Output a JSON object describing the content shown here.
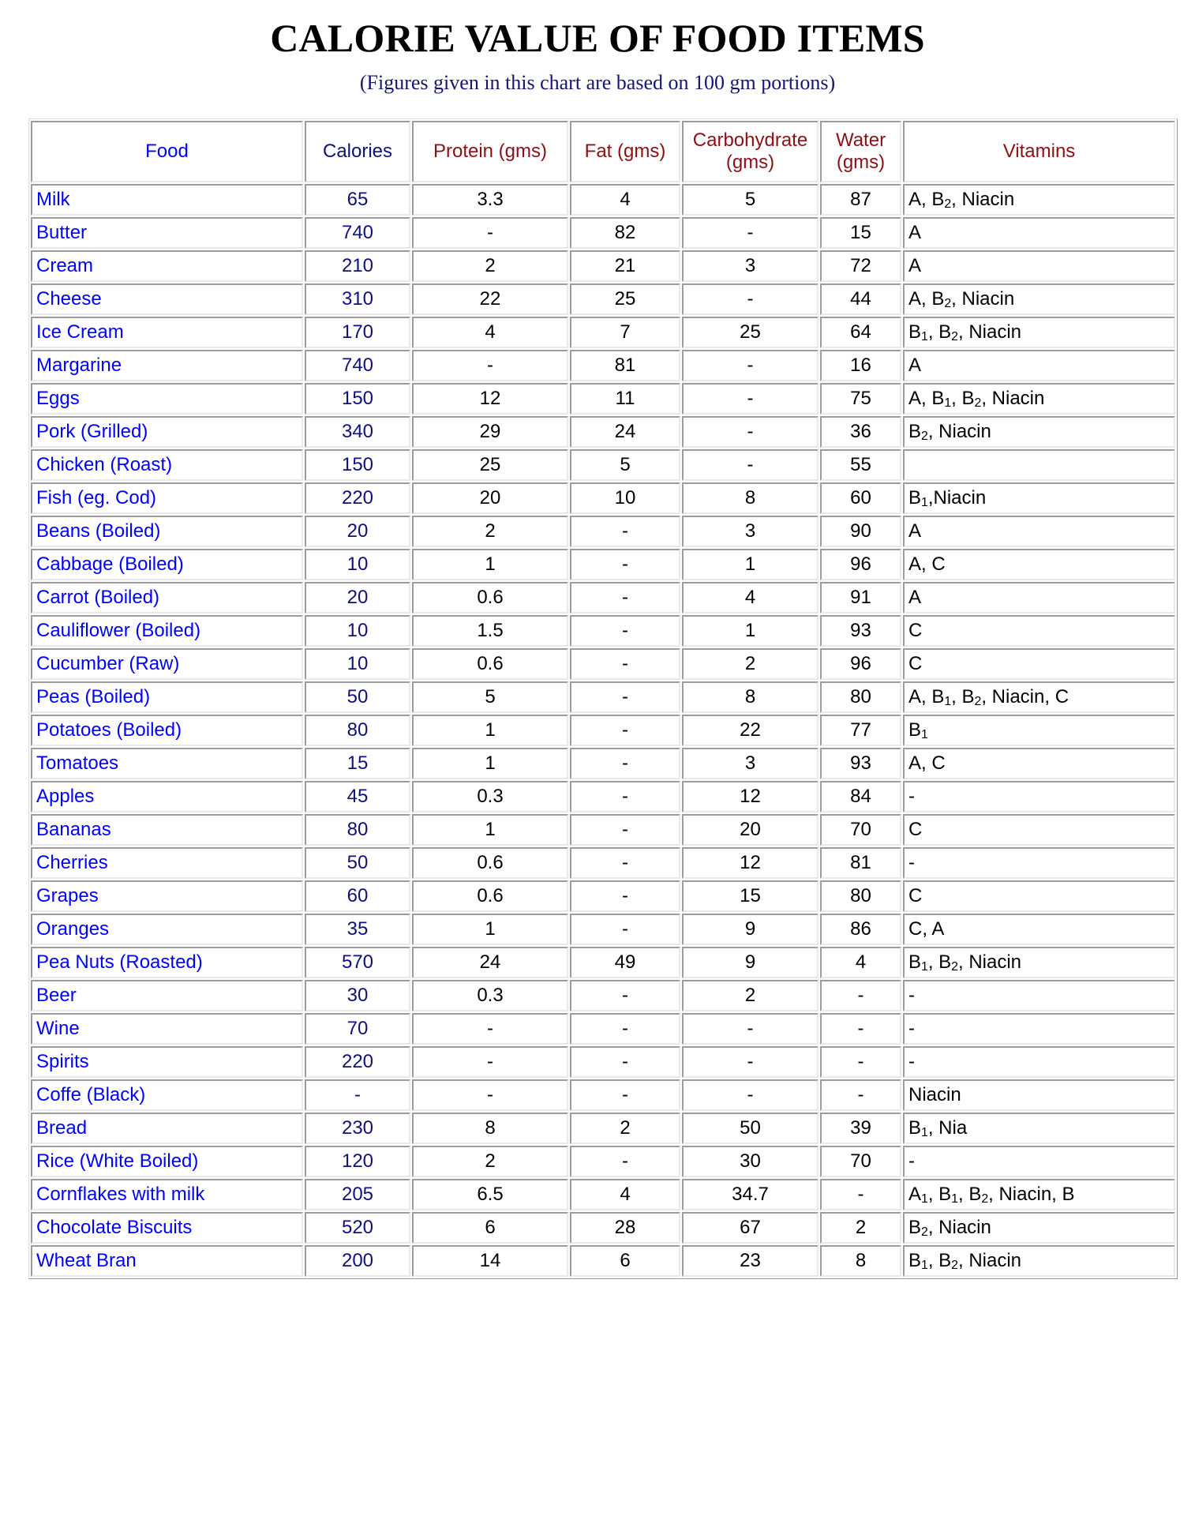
{
  "header": {
    "title": "CALORIE VALUE OF FOOD ITEMS",
    "subtitle": "(Figures given in this chart are based on 100 gm portions)",
    "title_color": "#000000",
    "subtitle_color": "#16166e"
  },
  "colors": {
    "food_text": "#0000ff",
    "calories_text": "#10107a",
    "numeric_text": "#000000",
    "header_red": "#8b1015",
    "header_blue_bright": "#0000ff",
    "header_blue_dark": "#10107a",
    "cell_border": "#9c9c9c",
    "page_background": "#ffffff"
  },
  "table": {
    "columns": [
      {
        "label": "Food",
        "color_role": "header_blue_bright"
      },
      {
        "label": "Calories",
        "color_role": "header_blue_dark"
      },
      {
        "label": "Protein (gms)",
        "color_role": "header_red"
      },
      {
        "label": "Fat (gms)",
        "color_role": "header_red"
      },
      {
        "label": "Carbohydrate (gms)",
        "color_role": "header_red"
      },
      {
        "label": "Water (gms)",
        "color_role": "header_red"
      },
      {
        "label": "Vitamins",
        "color_role": "header_red"
      }
    ]
  },
  "chart_data": {
    "type": "table",
    "title": "CALORIE VALUE OF FOOD ITEMS",
    "subtitle": "(Figures given in this chart are based on 100 gm portions)",
    "columns": [
      "Food",
      "Calories",
      "Protein (gms)",
      "Fat (gms)",
      "Carbohydrate (gms)",
      "Water (gms)",
      "Vitamins"
    ],
    "rows": [
      {
        "food": "Milk",
        "calories": "65",
        "protein": "3.3",
        "fat": "4",
        "carbohydrate": "5",
        "water": "87",
        "vitamins": "A, B<sub>2</sub>, Niacin"
      },
      {
        "food": "Butter",
        "calories": "740",
        "protein": "-",
        "fat": "82",
        "carbohydrate": "-",
        "water": "15",
        "vitamins": "A"
      },
      {
        "food": "Cream",
        "calories": "210",
        "protein": "2",
        "fat": "21",
        "carbohydrate": "3",
        "water": "72",
        "vitamins": "A"
      },
      {
        "food": "Cheese",
        "calories": "310",
        "protein": "22",
        "fat": "25",
        "carbohydrate": "-",
        "water": "44",
        "vitamins": "A, B<sub>2</sub>, Niacin"
      },
      {
        "food": "Ice Cream",
        "calories": "170",
        "protein": "4",
        "fat": "7",
        "carbohydrate": "25",
        "water": "64",
        "vitamins": "B<sub>1</sub>, B<sub>2</sub>, Niacin"
      },
      {
        "food": "Margarine",
        "calories": "740",
        "protein": "-",
        "fat": "81",
        "carbohydrate": "-",
        "water": "16",
        "vitamins": "A"
      },
      {
        "food": "Eggs",
        "calories": "150",
        "protein": "12",
        "fat": "11",
        "carbohydrate": "-",
        "water": "75",
        "vitamins": "A, B<sub>1</sub>, B<sub>2</sub>, Niacin"
      },
      {
        "food": "Pork (Grilled)",
        "calories": "340",
        "protein": "29",
        "fat": "24",
        "carbohydrate": "-",
        "water": "36",
        "vitamins": "B<sub>2</sub>, Niacin"
      },
      {
        "food": "Chicken (Roast)",
        "calories": "150",
        "protein": "25",
        "fat": "5",
        "carbohydrate": "-",
        "water": "55",
        "vitamins": ""
      },
      {
        "food": "Fish (eg. Cod)",
        "calories": "220",
        "protein": "20",
        "fat": "10",
        "carbohydrate": "8",
        "water": "60",
        "vitamins": "B<sub>1</sub>,Niacin"
      },
      {
        "food": "Beans (Boiled)",
        "calories": "20",
        "protein": "2",
        "fat": "-",
        "carbohydrate": "3",
        "water": "90",
        "vitamins": "A"
      },
      {
        "food": "Cabbage (Boiled)",
        "calories": "10",
        "protein": "1",
        "fat": "-",
        "carbohydrate": "1",
        "water": "96",
        "vitamins": "A, C"
      },
      {
        "food": "Carrot (Boiled)",
        "calories": "20",
        "protein": "0.6",
        "fat": "-",
        "carbohydrate": "4",
        "water": "91",
        "vitamins": "A"
      },
      {
        "food": "Cauliflower (Boiled)",
        "calories": "10",
        "protein": "1.5",
        "fat": "-",
        "carbohydrate": "1",
        "water": "93",
        "vitamins": "C"
      },
      {
        "food": "Cucumber (Raw)",
        "calories": "10",
        "protein": "0.6",
        "fat": "-",
        "carbohydrate": "2",
        "water": "96",
        "vitamins": "C"
      },
      {
        "food": "Peas (Boiled)",
        "calories": "50",
        "protein": "5",
        "fat": "-",
        "carbohydrate": "8",
        "water": "80",
        "vitamins": "A, B<sub>1</sub>, B<sub>2</sub>, Niacin, C"
      },
      {
        "food": "Potatoes (Boiled)",
        "calories": "80",
        "protein": "1",
        "fat": "-",
        "carbohydrate": "22",
        "water": "77",
        "vitamins": "B<sub>1</sub>"
      },
      {
        "food": "Tomatoes",
        "calories": "15",
        "protein": "1",
        "fat": "-",
        "carbohydrate": "3",
        "water": "93",
        "vitamins": "A, C"
      },
      {
        "food": "Apples",
        "calories": "45",
        "protein": "0.3",
        "fat": "-",
        "carbohydrate": "12",
        "water": "84",
        "vitamins": "-"
      },
      {
        "food": "Bananas",
        "calories": "80",
        "protein": "1",
        "fat": "-",
        "carbohydrate": "20",
        "water": "70",
        "vitamins": "C"
      },
      {
        "food": "Cherries",
        "calories": "50",
        "protein": "0.6",
        "fat": "-",
        "carbohydrate": "12",
        "water": "81",
        "vitamins": "-"
      },
      {
        "food": "Grapes",
        "calories": "60",
        "protein": "0.6",
        "fat": "-",
        "carbohydrate": "15",
        "water": "80",
        "vitamins": "C"
      },
      {
        "food": "Oranges",
        "calories": "35",
        "protein": "1",
        "fat": "-",
        "carbohydrate": "9",
        "water": "86",
        "vitamins": "C, A"
      },
      {
        "food": "Pea Nuts (Roasted)",
        "calories": "570",
        "protein": "24",
        "fat": "49",
        "carbohydrate": "9",
        "water": "4",
        "vitamins": "B<sub>1</sub>, B<sub>2</sub>, Niacin"
      },
      {
        "food": "Beer",
        "calories": "30",
        "protein": "0.3",
        "fat": "-",
        "carbohydrate": "2",
        "water": "-",
        "vitamins": "-"
      },
      {
        "food": "Wine",
        "calories": "70",
        "protein": "-",
        "fat": "-",
        "carbohydrate": "-",
        "water": "-",
        "vitamins": "-"
      },
      {
        "food": "Spirits",
        "calories": "220",
        "protein": "-",
        "fat": "-",
        "carbohydrate": "-",
        "water": "-",
        "vitamins": "-"
      },
      {
        "food": "Coffe (Black)",
        "calories": "-",
        "protein": "-",
        "fat": "-",
        "carbohydrate": "-",
        "water": "-",
        "vitamins": "Niacin"
      },
      {
        "food": "Bread",
        "calories": "230",
        "protein": "8",
        "fat": "2",
        "carbohydrate": "50",
        "water": "39",
        "vitamins": "B<sub>1</sub>, Nia"
      },
      {
        "food": "Rice (White Boiled)",
        "calories": "120",
        "protein": "2",
        "fat": "-",
        "carbohydrate": "30",
        "water": "70",
        "vitamins": "-"
      },
      {
        "food": "Cornflakes with milk",
        "calories": "205",
        "protein": "6.5",
        "fat": "4",
        "carbohydrate": "34.7",
        "water": "-",
        "vitamins": "A<sub>1</sub>, B<sub>1</sub>, B<sub>2</sub>, Niacin, B"
      },
      {
        "food": "Chocolate Biscuits",
        "calories": "520",
        "protein": "6",
        "fat": "28",
        "carbohydrate": "67",
        "water": "2",
        "vitamins": "B<sub>2</sub>, Niacin"
      },
      {
        "food": "Wheat Bran",
        "calories": "200",
        "protein": "14",
        "fat": "6",
        "carbohydrate": "23",
        "water": "8",
        "vitamins": "B<sub>1</sub>, B<sub>2</sub>, Niacin"
      }
    ]
  }
}
